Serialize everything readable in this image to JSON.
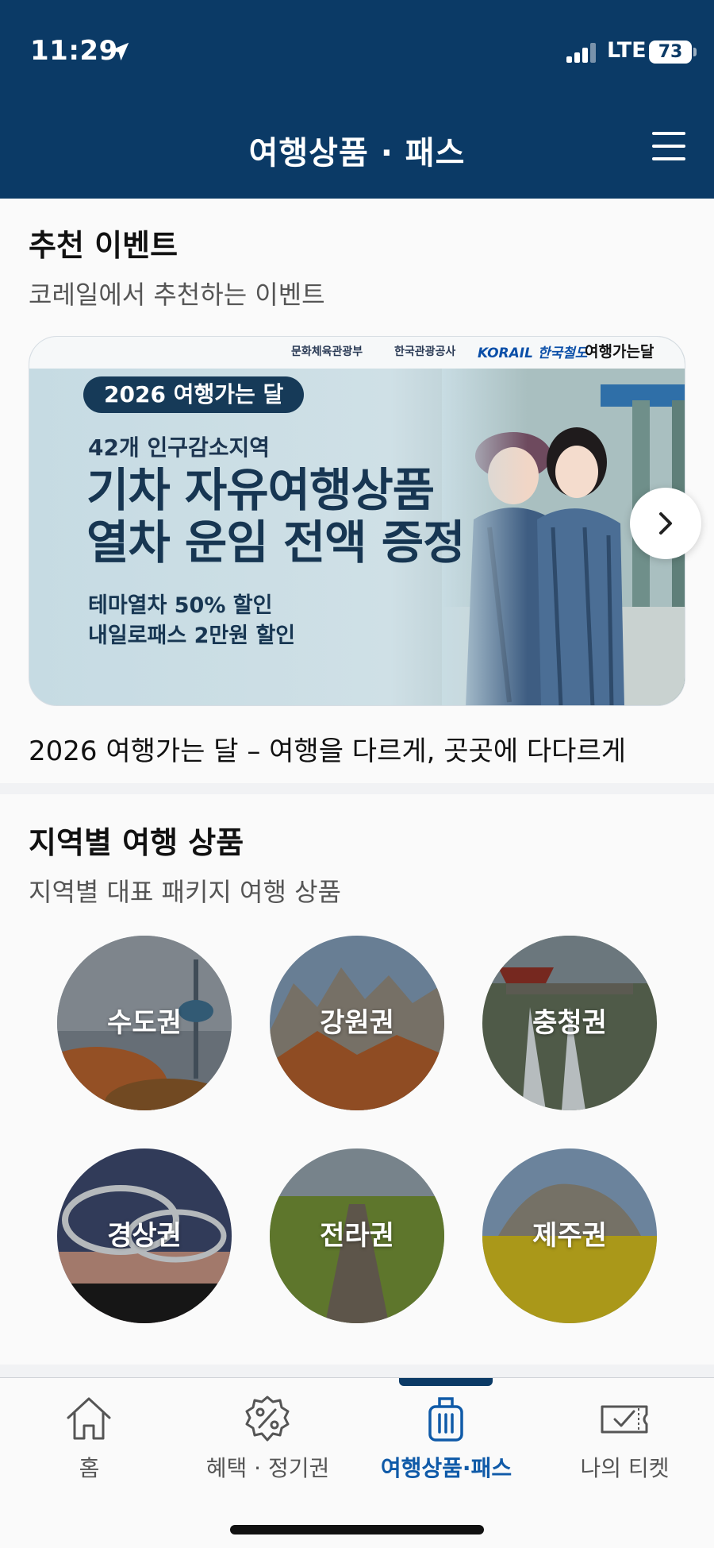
{
  "status_bar": {
    "time": "11:29",
    "network": "LTE",
    "battery": "73"
  },
  "header": {
    "title": "여행상품 · 패스"
  },
  "recommended": {
    "title": "추천 이벤트",
    "subtitle": "코레일에서 추천하는 이벤트",
    "banner": {
      "logos": [
        "문화체육관광부",
        "한국관광공사",
        "KORAIL 한국철도",
        "여행가는달"
      ],
      "pill": "2026 여행가는 달",
      "line1": "42개 인구감소지역",
      "headline1": "기차 자유여행상품",
      "headline2": "열차 운임 전액 증정",
      "sub1": "테마열차 50% 할인",
      "sub2": "내일로패스 2만원 할인"
    },
    "caption": "2026 여행가는 달 – 여행을 다르게, 곳곳에 다다르게"
  },
  "regions": {
    "title": "지역별 여행 상품",
    "subtitle": "지역별 대표 패키지 여행 상품",
    "items": [
      {
        "label": "수도권"
      },
      {
        "label": "강원권"
      },
      {
        "label": "충청권"
      },
      {
        "label": "경상권"
      },
      {
        "label": "전라권"
      },
      {
        "label": "제주권"
      }
    ]
  },
  "tabs": [
    {
      "label": "홈",
      "icon": "home-icon"
    },
    {
      "label": "혜택 · 정기권",
      "icon": "discount-badge-icon"
    },
    {
      "label": "여행상품·패스",
      "icon": "suitcase-icon",
      "active": true
    },
    {
      "label": "나의 티켓",
      "icon": "ticket-icon"
    }
  ],
  "colors": {
    "header_bg": "#0b3a66",
    "active_tab": "#0f5aa8"
  }
}
